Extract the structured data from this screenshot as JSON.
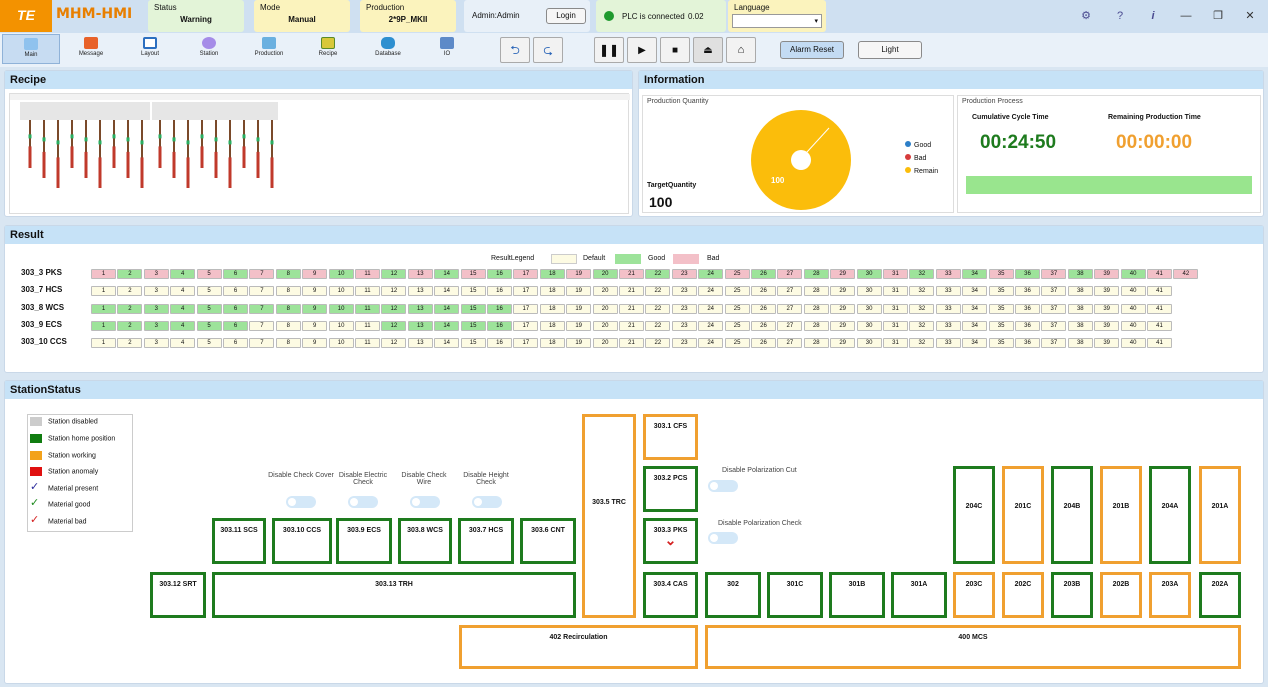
{
  "header": {
    "logo": "TE",
    "app_title": "MHM-HMI",
    "status_label": "Status",
    "status_value": "Warning",
    "mode_label": "Mode",
    "mode_value": "Manual",
    "production_label": "Production",
    "production_value": "2*9P_MKII",
    "user": "Admin:Admin",
    "login": "Login",
    "plc": "PLC is connected",
    "plc_value": "0.02",
    "language_label": "Language"
  },
  "nav": [
    "Main",
    "Message",
    "Layout",
    "Station",
    "Production",
    "Recipe",
    "Database",
    "IO"
  ],
  "toolbar": {
    "alarm_reset": "Alarm Reset",
    "light": "Light"
  },
  "recipe": {
    "title": "Recipe"
  },
  "info": {
    "title": "Information",
    "pq_label": "Production Quantity",
    "target_label": "TargetQuantity",
    "target_value": "100",
    "pie_value": "100",
    "legend": [
      "Good",
      "Bad",
      "Remain"
    ],
    "pp_label": "Production Process",
    "cycle_label": "Cumulative Cycle Time",
    "cycle_value": "00:24:50",
    "remain_label": "Remaining Production Time",
    "remain_value": "00:00:00"
  },
  "result": {
    "title": "Result",
    "legend_label": "ResultLegend",
    "legend": [
      "Default",
      "Good",
      "Bad"
    ],
    "rows": [
      {
        "name": "303_3 PKS",
        "count": 42,
        "status": "bgbgbgbgbgbgbgbgbgbgbgbgbgbgbgbgbgbgbgbgbb"
      },
      {
        "name": "303_7 HCS",
        "count": 41,
        "status": ""
      },
      {
        "name": "303_8 WCS",
        "count": 41,
        "status": "gggggggggggggggg"
      },
      {
        "name": "303_9 ECS",
        "count": 41,
        "status": "ggggggdddddgggggd"
      },
      {
        "name": "303_10 CCS",
        "count": 41,
        "status": ""
      }
    ]
  },
  "station": {
    "title": "StationStatus",
    "legend": [
      "Station disabled",
      "Station home position",
      "Station working",
      "Station anomaly",
      "Material present",
      "Material good",
      "Material bad"
    ],
    "toggles": {
      "cover": "Disable Check Cover",
      "electric": "Disable Electric Check",
      "wire": "Disable Check Wire",
      "height": "Disable Height Check",
      "pol_cut": "Disable Polarization Cut",
      "pol_check": "Disable Polarization Check"
    },
    "names": {
      "s3011": "303.11 SCS",
      "s3010": "303.10 CCS",
      "s309": "303.9 ECS",
      "s308": "303.8 WCS",
      "s307": "303.7 HCS",
      "s306": "303.6 CNT",
      "s3012": "303.12 SRT",
      "s3013": "303.13 TRH",
      "s305": "303.5 TRC",
      "s301": "303.1 CFS",
      "s302": "303.2 PCS",
      "s303": "303.3 PKS",
      "s304": "303.4 CAS",
      "s302b": "302",
      "s301c": "301C",
      "s301b": "301B",
      "s301a": "301A",
      "s204c": "204C",
      "s201c": "201C",
      "s204b": "204B",
      "s201b": "201B",
      "s204a": "204A",
      "s201a": "201A",
      "s203c": "203C",
      "s202c": "202C",
      "s203b": "203B",
      "s202b": "202B",
      "s203a": "203A",
      "s202a": "202A",
      "s402": "402 Recirculation",
      "s400": "400 MCS"
    }
  }
}
